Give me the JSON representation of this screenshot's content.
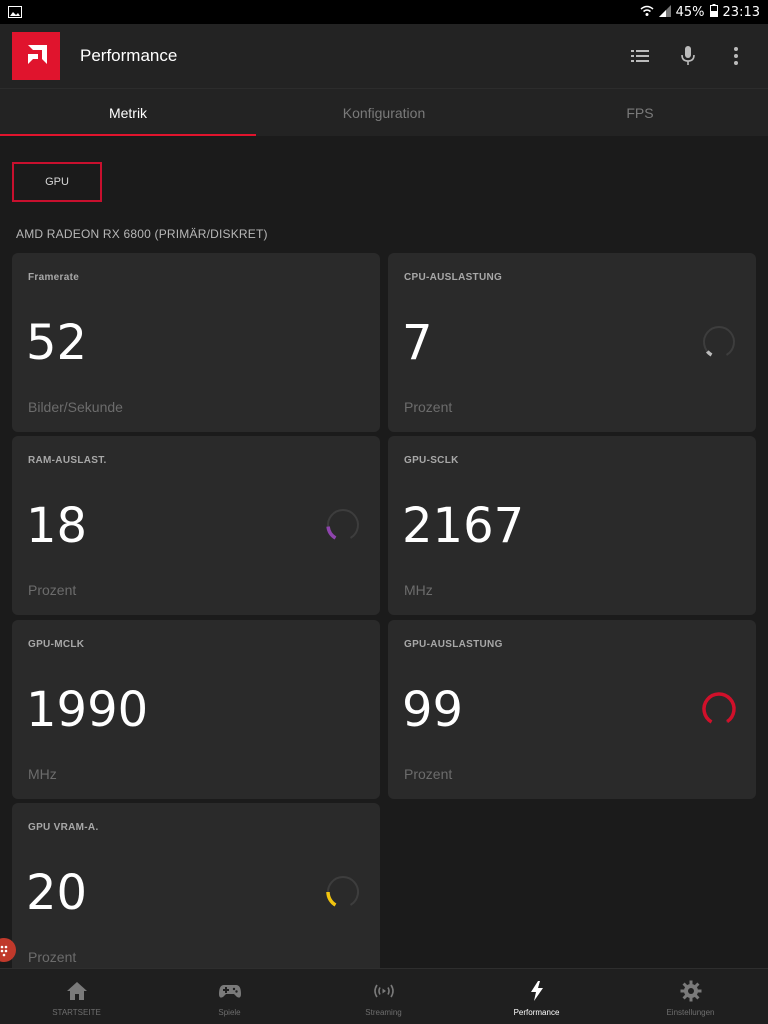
{
  "status_bar": {
    "battery": "45%",
    "time": "23:13"
  },
  "app": {
    "title": "Performance"
  },
  "tabs": [
    {
      "label": "Metrik"
    },
    {
      "label": "Konfiguration"
    },
    {
      "label": "FPS"
    }
  ],
  "filter": {
    "gpu_label": "GPU"
  },
  "device_name": "AMD RADEON RX 6800 (PRIMÄR/DISKRET)",
  "cards": [
    {
      "label": "Framerate",
      "value": "52",
      "unit": "Bilder/Sekunde"
    },
    {
      "label": "CPU-AUSLASTUNG",
      "value": "7",
      "unit": "Prozent",
      "gauge_fraction": 0.07,
      "gauge_color": "#bbbbbb"
    },
    {
      "label": "RAM-AUSLAST.",
      "value": "18",
      "unit": "Prozent",
      "gauge_fraction": 0.18,
      "gauge_color": "#8e44ad"
    },
    {
      "label": "GPU-SCLK",
      "value": "2167",
      "unit": "MHz"
    },
    {
      "label": "GPU-MCLK",
      "value": "1990",
      "unit": "MHz"
    },
    {
      "label": "GPU-AUSLASTUNG",
      "value": "99",
      "unit": "Prozent",
      "gauge_fraction": 0.99,
      "gauge_color": "#d0102a"
    },
    {
      "label": "GPU VRAM-A.",
      "value": "20",
      "unit": "Prozent",
      "gauge_fraction": 0.2,
      "gauge_color": "#f1c40f"
    }
  ],
  "bottom_nav": [
    {
      "label": "STARTSEITE",
      "icon": "home-icon"
    },
    {
      "label": "Spiele",
      "icon": "gamepad-icon"
    },
    {
      "label": "Streaming",
      "icon": "streaming-icon"
    },
    {
      "label": "Performance",
      "icon": "lightning-icon"
    },
    {
      "label": "Einstellungen",
      "icon": "gear-icon"
    }
  ],
  "colors": {
    "accent": "#e0142d",
    "card_bg": "#2a2a2a",
    "page_bg": "#1b1b1b"
  }
}
